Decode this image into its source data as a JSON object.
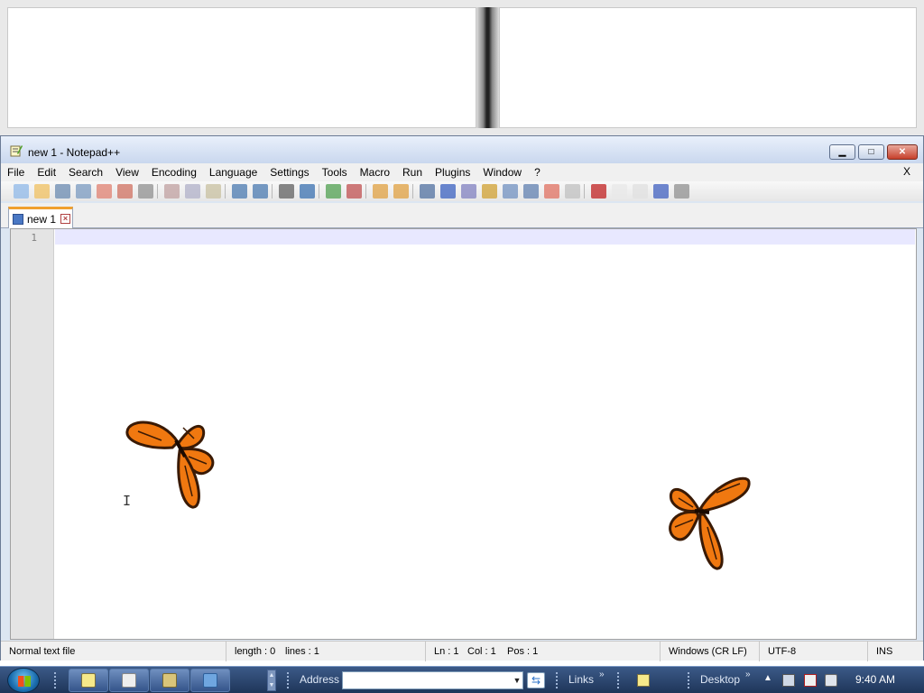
{
  "window": {
    "title": "new 1 - Notepad++",
    "minimize_glyph": "▁",
    "maximize_glyph": "□",
    "close_glyph": "✕"
  },
  "menu": {
    "items": [
      "File",
      "Edit",
      "Search",
      "View",
      "Encoding",
      "Language",
      "Settings",
      "Tools",
      "Macro",
      "Run",
      "Plugins",
      "Window",
      "?"
    ],
    "close_label": "X"
  },
  "tabs": [
    {
      "label": "new 1",
      "active": true
    }
  ],
  "editor": {
    "line_numbers": [
      "1"
    ],
    "content": ""
  },
  "statusbar": {
    "file_type": "Normal text file",
    "length": "length : 0",
    "lines": "lines : 1",
    "ln": "Ln : 1",
    "col": "Col : 1",
    "pos": "Pos : 1",
    "eol": "Windows (CR LF)",
    "encoding": "UTF-8",
    "mode": "INS"
  },
  "taskbar": {
    "address_label": "Address",
    "address_value": "",
    "links_label": "Links",
    "desktop_label": "Desktop",
    "clock": "9:40 AM",
    "chevron": "»",
    "tray_arrow": "▲"
  },
  "colors": {
    "title_gradient_top": "#e9f0fb",
    "title_gradient_bottom": "#c9d7ee",
    "taskbar": "#2a4670",
    "current_line": "#e8e8ff",
    "gutter": "#e4e4e4",
    "butterfly": "#f07810"
  },
  "icons": {
    "toolbar": [
      "new-icon",
      "open-icon",
      "save-icon",
      "save-all-icon",
      "close-icon",
      "close-all-icon",
      "print-icon",
      "cut-icon",
      "copy-icon",
      "paste-icon",
      "undo-icon",
      "redo-icon",
      "find-icon",
      "replace-icon",
      "zoom-in-icon",
      "zoom-out-icon",
      "sync-vertical-icon",
      "sync-horizontal-icon",
      "word-wrap-icon",
      "show-all-chars-icon",
      "indent-guide-icon",
      "user-lang-icon",
      "doc-map-icon",
      "function-list-icon",
      "folder-workspace-icon",
      "monitoring-icon",
      "record-macro-icon",
      "stop-macro-icon",
      "play-macro-icon",
      "run-macro-multiple-icon",
      "save-macro-icon"
    ]
  }
}
